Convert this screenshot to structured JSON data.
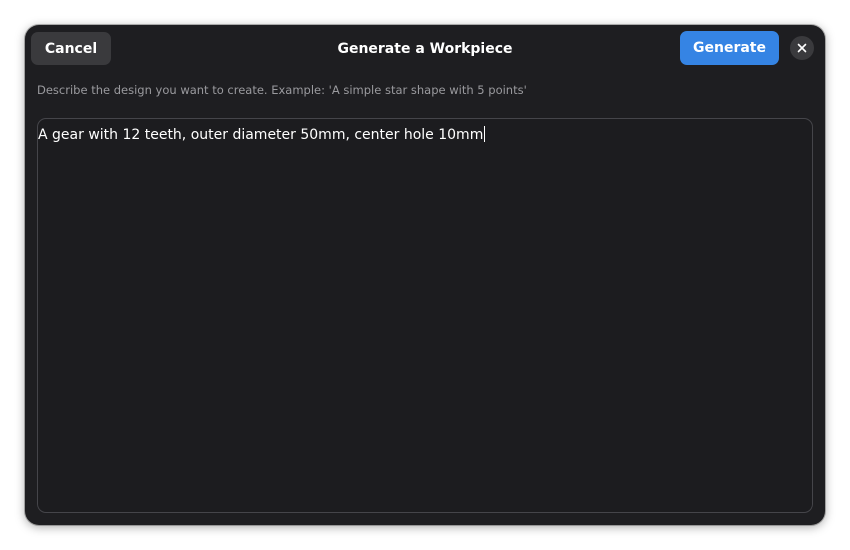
{
  "dialog": {
    "title": "Generate a Workpiece",
    "cancel_label": "Cancel",
    "generate_label": "Generate",
    "close_icon": "close-icon",
    "hint": "Describe the design you want to create. Example: 'A simple star shape with 5 points'",
    "prompt_text": "A gear with 12 teeth, outer diameter 50mm, center hole 10mm"
  },
  "colors": {
    "dialog_bg": "#1e1e21",
    "button_bg": "#3a3a3d",
    "accent": "#3584e4",
    "hint_text": "#9a9a9e",
    "text": "#ffffff"
  }
}
